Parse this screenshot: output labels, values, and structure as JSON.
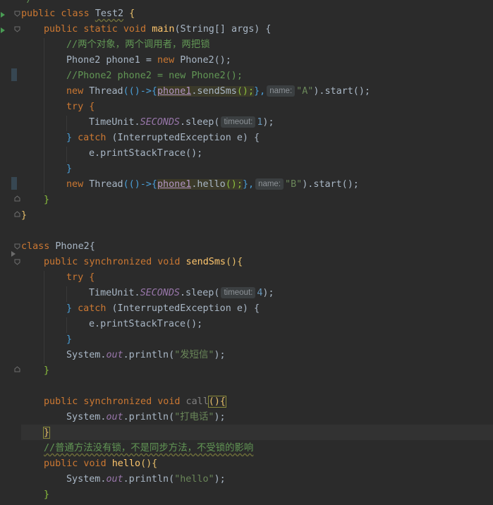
{
  "lines": {
    "l0": {
      "t": "*/"
    },
    "l1": {
      "a": "public class ",
      "b": "Test2",
      "c": " {"
    },
    "l2": {
      "a": "public static void ",
      "b": "main",
      "c": "(String[] args) {"
    },
    "l3": {
      "a": "//两个对象，两个调用者，两把锁"
    },
    "l4": {
      "a": "Phone2 phone1 = ",
      "b": "new ",
      "c": "Phone2();"
    },
    "l5": {
      "a": "//Phone2 phone2 = new Phone2();"
    },
    "l6": {
      "a": "new ",
      "b": "Thread",
      "c": "(()->{",
      "d": "phone1",
      "e": ".sendSms",
      "f": "();",
      "g": "},",
      "hint": "name:",
      "h": "\"A\"",
      "i": ").start();"
    },
    "l7": {
      "a": "try {"
    },
    "l8": {
      "a": "TimeUnit.",
      "b": "SECONDS",
      "c": ".sleep(",
      "hint": "timeout:",
      "d": "1",
      "e": ");"
    },
    "l9": {
      "a": "} ",
      "b": "catch ",
      "c": "(InterruptedException e) {"
    },
    "l10": {
      "a": "e.printStackTrace();"
    },
    "l11": {
      "a": "}"
    },
    "l12": {
      "a": "new ",
      "b": "Thread",
      "c": "(()->{",
      "d": "phone1",
      "e": ".hello",
      "f": "();",
      "g": "},",
      "hint": "name:",
      "h": "\"B\"",
      "i": ").start();"
    },
    "l13": {
      "a": "}"
    },
    "l14": {
      "a": "}"
    },
    "l16": {
      "a": "class ",
      "b": "Phone2{"
    },
    "l17": {
      "a": "public synchronized void ",
      "b": "sendSms",
      "c": "(){"
    },
    "l18": {
      "a": "try {"
    },
    "l19": {
      "a": "TimeUnit.",
      "b": "SECONDS",
      "c": ".sleep(",
      "hint": "timeout:",
      "d": "4",
      "e": ");"
    },
    "l20": {
      "a": "} ",
      "b": "catch ",
      "c": "(InterruptedException e) {"
    },
    "l21": {
      "a": "e.printStackTrace();"
    },
    "l22": {
      "a": "}"
    },
    "l23": {
      "a": "System.",
      "b": "out",
      "c": ".println(",
      "d": "\"发短信\"",
      "e": ");"
    },
    "l24": {
      "a": "}"
    },
    "l26": {
      "a": "public synchronized void ",
      "b": "call",
      "c": "(){"
    },
    "l27": {
      "a": "System.",
      "b": "out",
      "c": ".println(",
      "d": "\"打电话\"",
      "e": ");"
    },
    "l28": {
      "a": "}"
    },
    "l29": {
      "a": "//普通方法没有锁，不是同步方法，不受锁的影响"
    },
    "l30": {
      "a": "public void ",
      "b": "hello",
      "c": "(){"
    },
    "l31": {
      "a": "System.",
      "b": "out",
      "c": ".println(",
      "d": "\"hello\"",
      "e": ");"
    },
    "l32": {
      "a": "}"
    }
  },
  "colors": {
    "background": "#2b2b2b",
    "keyword": "#cc7832",
    "string": "#6a8759",
    "method": "#ffc66d",
    "number": "#6897bb",
    "comment": "#629755",
    "static_field": "#9876aa"
  }
}
